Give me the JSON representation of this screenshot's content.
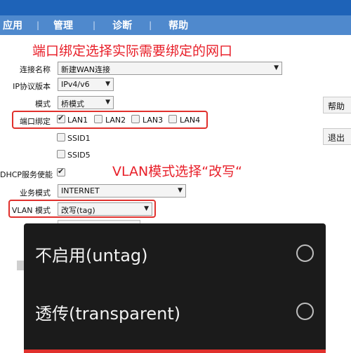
{
  "nav": {
    "items": [
      "应用",
      "管理",
      "诊断",
      "帮助"
    ],
    "separator": "|"
  },
  "annotations": {
    "port_binding_note": "端口绑定选择实际需要绑定的网口",
    "vlan_note": "VLAN模式选择“改写“"
  },
  "form": {
    "connection_name": {
      "label": "连接名称",
      "value": "新建WAN连接"
    },
    "ip_version": {
      "label": "IP协议版本",
      "value": "IPv4/v6"
    },
    "mode": {
      "label": "模式",
      "value": "桥模式"
    },
    "port_binding": {
      "label": "端口绑定",
      "options": [
        {
          "name": "LAN1",
          "checked": true
        },
        {
          "name": "LAN2",
          "checked": false
        },
        {
          "name": "LAN3",
          "checked": false
        },
        {
          "name": "LAN4",
          "checked": false
        },
        {
          "name": "SSID1",
          "checked": false
        },
        {
          "name": "SSID5",
          "checked": false
        }
      ]
    },
    "dhcp_service": {
      "label": "DHCP服务使能",
      "checked": true
    },
    "service_mode": {
      "label": "业务模式",
      "value": "INTERNET"
    },
    "vlan_mode": {
      "label": "VLAN 模式",
      "value": "改写(tag)"
    }
  },
  "side_buttons": {
    "help": "帮助",
    "exit": "退出"
  },
  "dropdown": {
    "options": [
      {
        "label": "不启用(untag)",
        "selected": false
      },
      {
        "label": "透传(transparent)",
        "selected": false
      }
    ]
  },
  "colors": {
    "header_dark": "#1e63b8",
    "header_nav": "#4f89cd",
    "annotation_red": "#e8202a",
    "dropdown_bg": "#1b1b1b"
  }
}
